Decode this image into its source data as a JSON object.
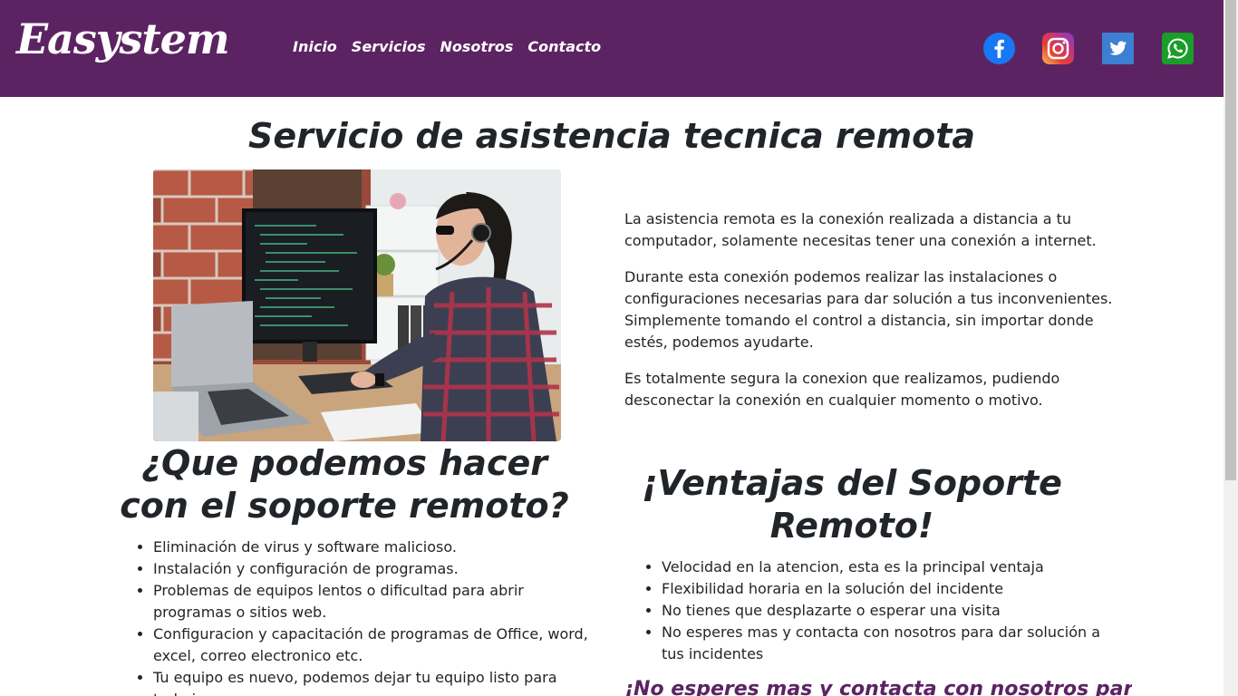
{
  "header": {
    "brand": "Easystem",
    "nav": [
      {
        "label": "Inicio"
      },
      {
        "label": "Servicios"
      },
      {
        "label": "Nosotros"
      },
      {
        "label": "Contacto"
      }
    ],
    "social": [
      {
        "icon": "facebook-icon",
        "color": "#1877f2"
      },
      {
        "icon": "instagram-icon",
        "color": "#c13584"
      },
      {
        "icon": "twitter-icon",
        "color": "#3d7fd1"
      },
      {
        "icon": "whatsapp-icon",
        "color": "#1a9e2a"
      }
    ],
    "background": "#5c2363"
  },
  "main": {
    "title": "Servicio de asistencia tecnica remota",
    "image_alt": "Técnica de soporte con auriculares trabajando en computadoras",
    "intro": [
      "La asistencia remota es la conexión realizada a distancia a tu computador, solamente necesitas tener una conexión a internet.",
      "Durante esta conexión podemos realizar las instalaciones o configuraciones necesarias para dar solución a tus inconvenientes. Simplemente tomando el control a distancia, sin importar donde estés, podemos ayudarte.",
      "Es totalmente segura la conexion que realizamos, pudiendo desconectar la conexión en cualquier momento o motivo."
    ],
    "que_heading": "¿Que podemos hacer con el soporte remoto?",
    "que_items": [
      "Eliminación de virus y software malicioso.",
      "Instalación y configuración de programas.",
      "Problemas de equipos lentos o dificultad para abrir programas o sitios web.",
      "Configuracion y capacitación de programas de Office, word, excel, correo electronico etc.",
      "Tu equipo es nuevo, podemos dejar tu equipo listo para trabajar."
    ],
    "ventajas_heading": "¡Ventajas del Soporte Remoto!",
    "ventajas_items": [
      "Velocidad en la atencion, esta es la principal ventaja",
      "Flexibilidad horaria en la solución del incidente",
      "No tienes que desplazarte o esperar una visita",
      "No esperes mas y contacta con nosotros para dar solución a tus incidentes"
    ],
    "cta": "¡No esperes mas y contacta con nosotros para"
  }
}
